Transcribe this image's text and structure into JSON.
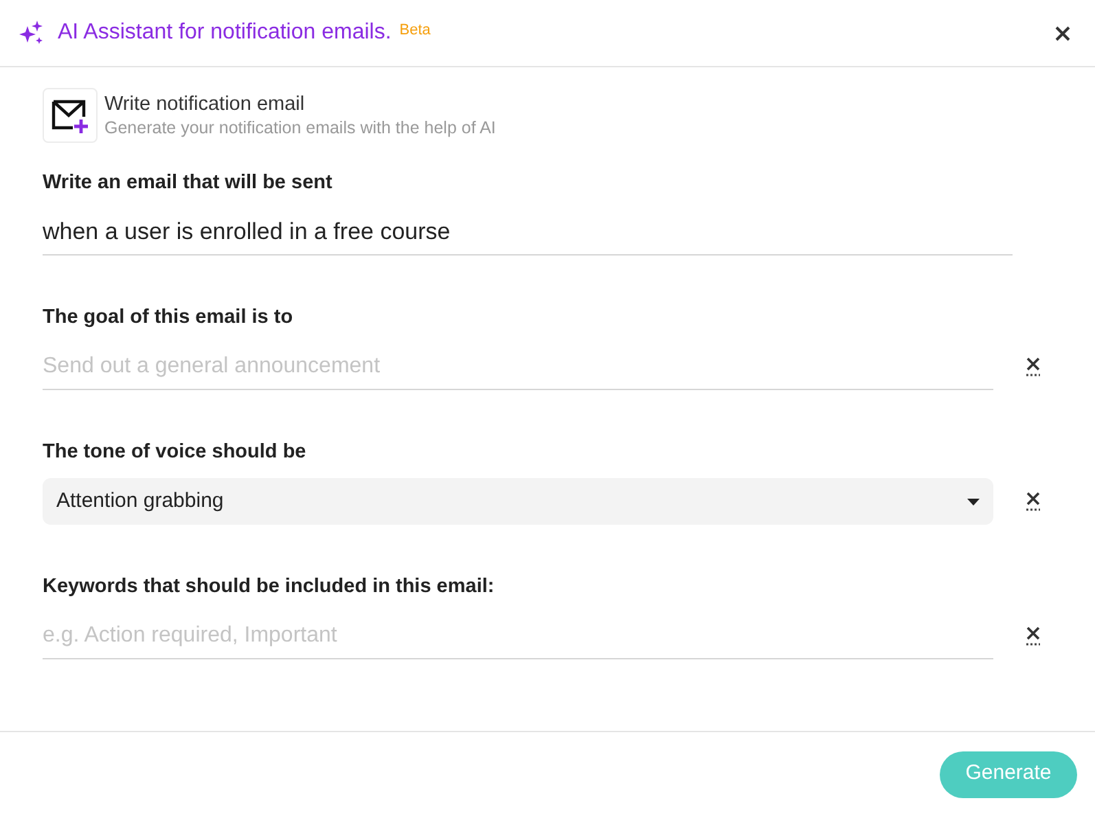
{
  "dialog": {
    "title": "AI Assistant for notification emails.",
    "badge": "Beta"
  },
  "intro": {
    "title": "Write notification email",
    "subtitle": "Generate your notification emails with the help of AI"
  },
  "fields": [
    {
      "kind": "text",
      "label": "Write an email that will be sent",
      "value": "when a user is enrolled in a free course",
      "clearable": false
    },
    {
      "kind": "text",
      "label": "The goal of this email is to",
      "placeholder": "Send out a general announcement",
      "clearable": true
    },
    {
      "kind": "select",
      "label": "The tone of voice should be",
      "value": "Attention grabbing",
      "clearable": true
    },
    {
      "kind": "text",
      "label": "Keywords that should be included in this email:",
      "placeholder": "e.g. Action required, Important",
      "clearable": true
    }
  ],
  "footer": {
    "button": "Generate"
  }
}
